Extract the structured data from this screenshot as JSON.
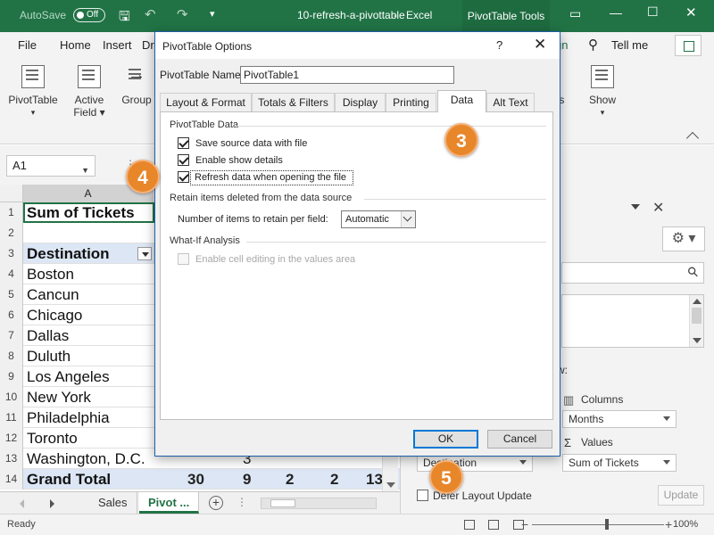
{
  "titlebar": {
    "autosave_label": "AutoSave",
    "autosave_state": "Off",
    "filename": "10-refresh-a-pivottable",
    "app": "Excel",
    "context_tab": "PivotTable Tools",
    "colors": {
      "excel_green": "#217346",
      "context_green": "#1e6b40"
    }
  },
  "ribbon_tabs": [
    "File",
    "Home",
    "Insert",
    "Dr",
    "gn",
    "Tell me"
  ],
  "ribbon_buttons": [
    {
      "label": "PivotTable",
      "icon": "pivottable-icon"
    },
    {
      "label": "Active\nField",
      "icon": "active-field-icon"
    },
    {
      "label": "Group",
      "icon": "group-icon"
    },
    {
      "label": "ls",
      "icon": ""
    },
    {
      "label": "Show",
      "icon": "show-icon"
    }
  ],
  "namebox": "A1",
  "sheet": {
    "col_header": "A",
    "rows": [
      {
        "n": "1",
        "text": "Sum of Tickets",
        "bold": true
      },
      {
        "n": "2",
        "text": ""
      },
      {
        "n": "3",
        "text": "Destination",
        "bold": true,
        "filter": true
      },
      {
        "n": "4",
        "text": "Boston"
      },
      {
        "n": "5",
        "text": "Cancun"
      },
      {
        "n": "6",
        "text": "Chicago"
      },
      {
        "n": "7",
        "text": "Dallas"
      },
      {
        "n": "8",
        "text": "Duluth"
      },
      {
        "n": "9",
        "text": "Los Angeles"
      },
      {
        "n": "10",
        "text": "New York"
      },
      {
        "n": "11",
        "text": "Philadelphia"
      },
      {
        "n": "12",
        "text": "Toronto"
      },
      {
        "n": "13",
        "text": "Washington, D.C.",
        "extra": "3"
      },
      {
        "n": "14",
        "text": "Grand Total",
        "bold": true,
        "totals": [
          "30",
          "9",
          "2",
          "2",
          "13"
        ]
      }
    ],
    "tabs": [
      "Sales",
      "Pivot ..."
    ]
  },
  "status": {
    "ready": "Ready",
    "zoom": "100%"
  },
  "field_pane": {
    "partial_label": "w:",
    "columns_label": "Columns",
    "columns_value": "Months",
    "values_label": "Values",
    "values_sigma": "Σ",
    "values_value": "Sum of Tickets",
    "rows_value": "Destination",
    "defer_label": "Defer Layout Update",
    "update_label": "Update"
  },
  "dialog": {
    "title": "PivotTable Options",
    "help": "?",
    "name_label": "PivotTable Name:",
    "name_value": "PivotTable1",
    "tabs": [
      "Layout & Format",
      "Totals & Filters",
      "Display",
      "Printing",
      "Data",
      "Alt Text"
    ],
    "active_tab": "Data",
    "section_data": "PivotTable Data",
    "chk_save": "Save source data with file",
    "chk_details": "Enable show details",
    "chk_refresh": "Refresh data when opening the file",
    "section_retain": "Retain items deleted from the data source",
    "retain_label": "Number of items to retain per field:",
    "retain_value": "Automatic",
    "section_whatif": "What-If Analysis",
    "chk_whatif": "Enable cell editing in the values area",
    "ok": "OK",
    "cancel": "Cancel",
    "checks": {
      "save": true,
      "details": true,
      "refresh": true,
      "whatif": false
    }
  },
  "callouts": [
    "3",
    "4",
    "5"
  ],
  "accent_color": "#e8862a"
}
